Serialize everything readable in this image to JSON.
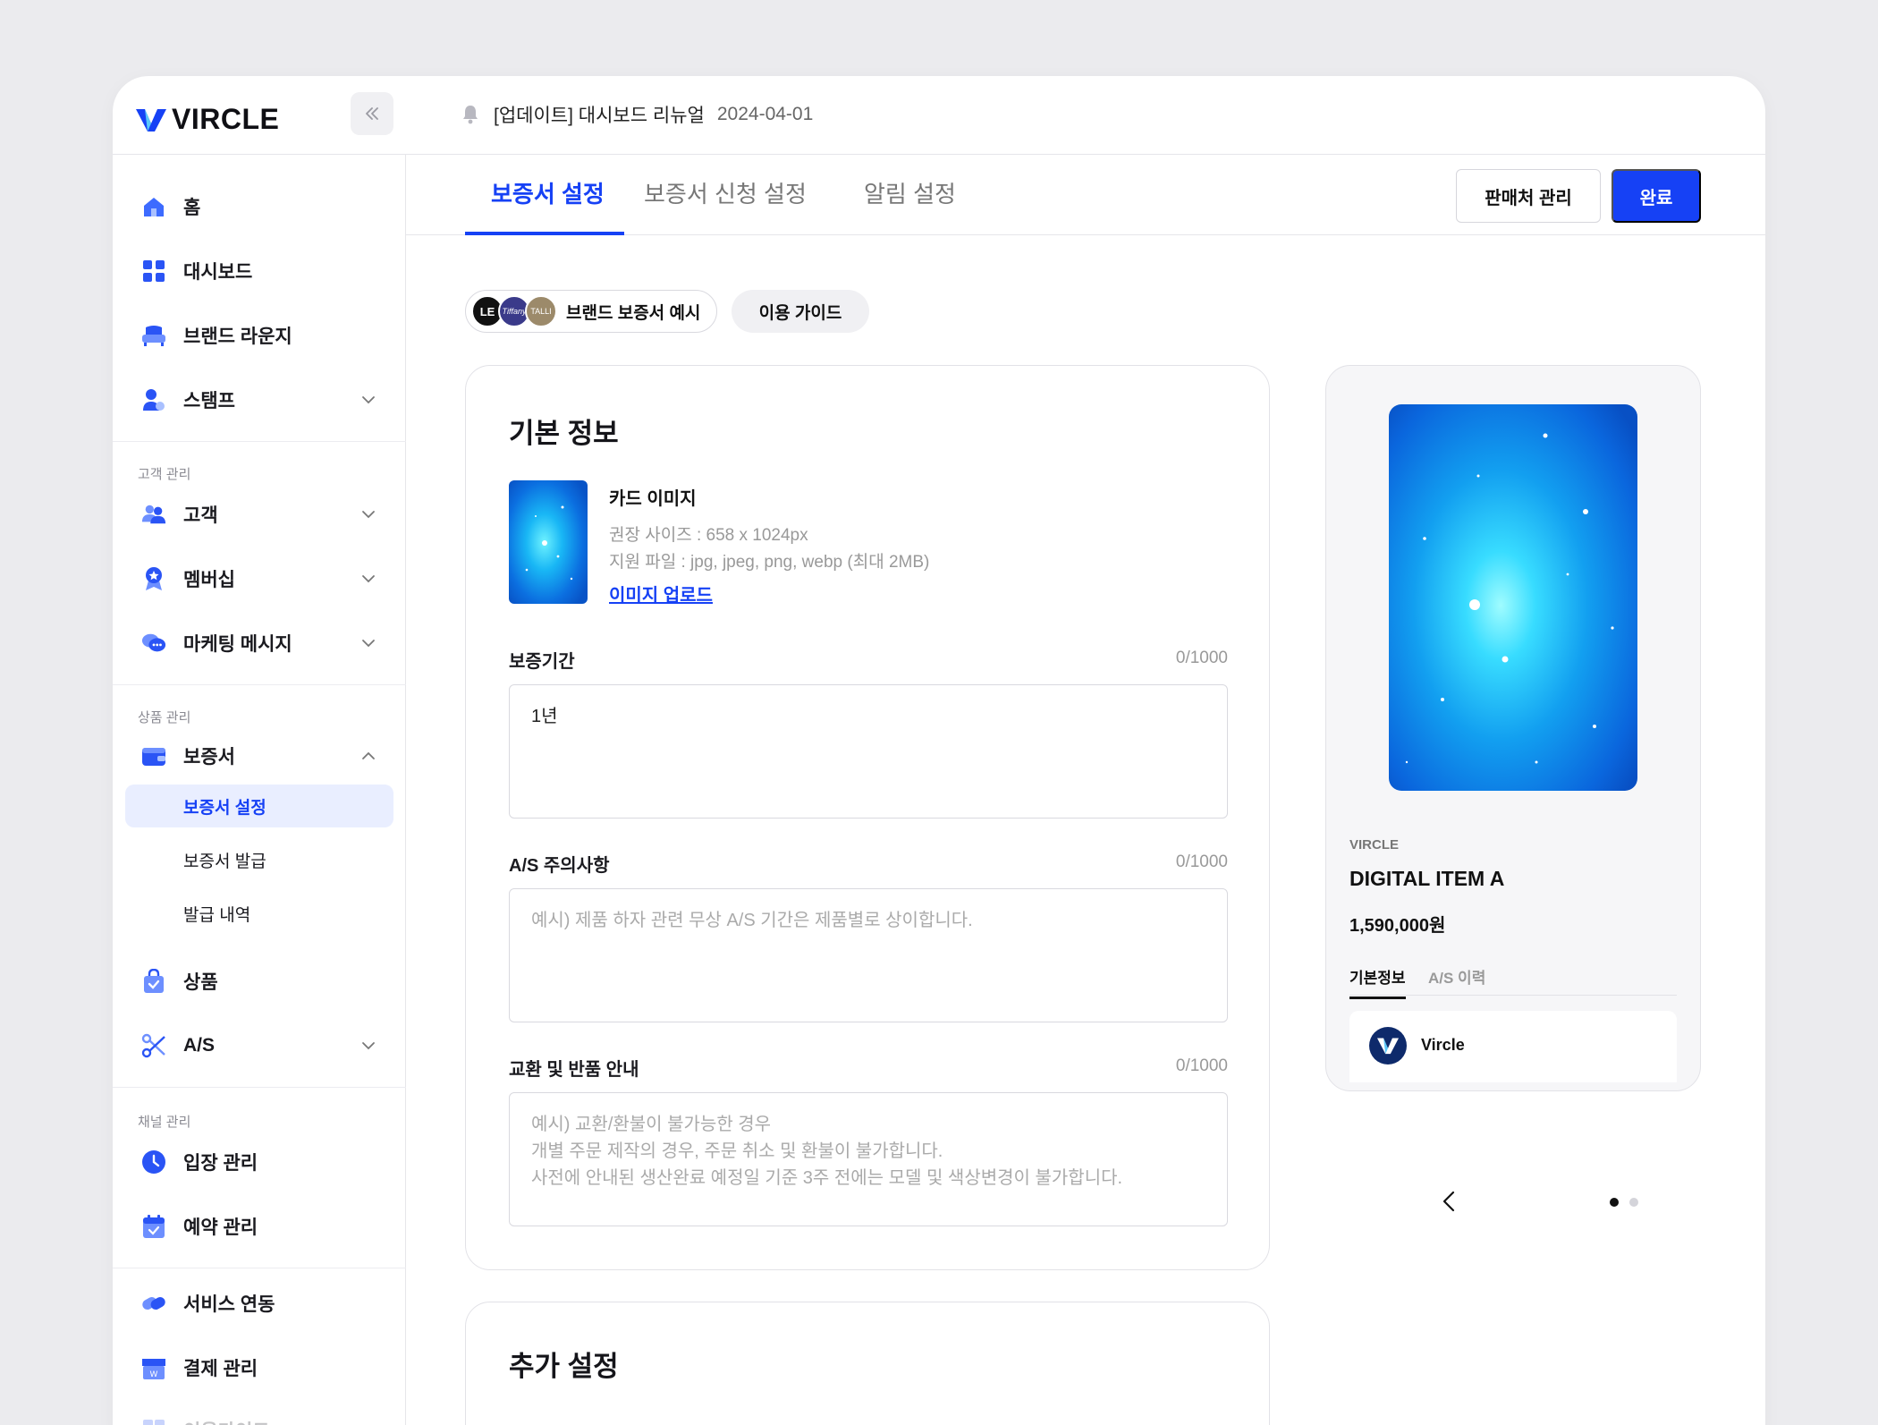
{
  "brand": {
    "name": "VIRCLE",
    "accent": "#1641f5"
  },
  "notice": {
    "text": "[업데이트] 대시보드 리뉴얼",
    "date": "2024-04-01"
  },
  "sidebar": {
    "items_top": [
      {
        "label": "홈",
        "icon": "home-icon"
      },
      {
        "label": "대시보드",
        "icon": "dashboard-icon"
      },
      {
        "label": "브랜드 라운지",
        "icon": "sofa-icon"
      },
      {
        "label": "스탬프",
        "icon": "stamp-icon",
        "expandable": true
      }
    ],
    "section_customer": "고객 관리",
    "items_customer": [
      {
        "label": "고객",
        "icon": "users-icon"
      },
      {
        "label": "멤버십",
        "icon": "badge-icon"
      },
      {
        "label": "마케팅 메시지",
        "icon": "chat-icon"
      }
    ],
    "section_product": "상품 관리",
    "warranty": {
      "label": "보증서",
      "icon": "wallet-icon"
    },
    "warranty_sub": [
      {
        "label": "보증서 설정",
        "active": true
      },
      {
        "label": "보증서 발급"
      },
      {
        "label": "발급 내역"
      }
    ],
    "items_product": [
      {
        "label": "상품",
        "icon": "bag-icon"
      },
      {
        "label": "A/S",
        "icon": "scissors-icon"
      }
    ],
    "section_channel": "채널 관리",
    "items_channel": [
      {
        "label": "입장 관리",
        "icon": "clock-icon"
      },
      {
        "label": "예약 관리",
        "icon": "calendar-icon"
      }
    ],
    "items_bottom": [
      {
        "label": "서비스 연동",
        "icon": "link-icon"
      },
      {
        "label": "결제 관리",
        "icon": "store-icon"
      },
      {
        "label": "이용가이드",
        "icon": "guide-icon"
      }
    ]
  },
  "tabs": [
    "보증서 설정",
    "보증서 신청 설정",
    "알림 설정"
  ],
  "actions": {
    "seller": "판매처 관리",
    "done": "완료"
  },
  "chips": {
    "brand_example": "브랜드 보증서 예시",
    "guide": "이용 가이드",
    "avatars": [
      "LE",
      "Tiffany",
      "TALLI"
    ]
  },
  "basic_info": {
    "title": "기본 정보",
    "card_image": {
      "title": "카드 이미지",
      "size": "권장 사이즈 : 658 x 1024px",
      "formats": "지원 파일 : jpg, jpeg, png, webp (최대 2MB)",
      "upload": "이미지 업로드"
    },
    "fields": [
      {
        "label": "보증기간",
        "count": "0/1000",
        "value": "1년",
        "placeholder": ""
      },
      {
        "label": "A/S 주의사항",
        "count": "0/1000",
        "value": "",
        "placeholder": "예시) 제품 하자 관련 무상 A/S 기간은 제품별로 상이합니다."
      },
      {
        "label": "교환 및 반품 안내",
        "count": "0/1000",
        "value": "",
        "placeholder": "예시) 교환/환불이 불가능한 경우\n개별 주문 제작의 경우, 주문 취소 및 환불이 불가합니다.\n사전에 안내된 생산완료 예정일 기준 3주 전에는 모델 및 색상변경이 불가합니다."
      }
    ]
  },
  "extra": {
    "title": "추가 설정"
  },
  "preview": {
    "brand": "VIRCLE",
    "name": "DIGITAL ITEM A",
    "price": "1,590,000원",
    "tabs": [
      "기본정보",
      "A/S 이력"
    ],
    "seller": "Vircle",
    "page": 1,
    "pages": 2
  }
}
